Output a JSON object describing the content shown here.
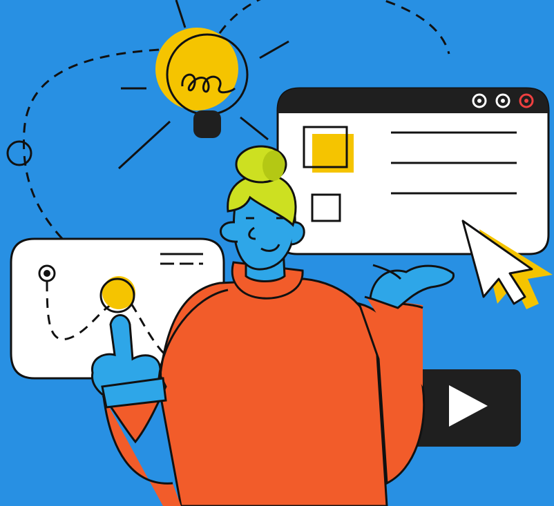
{
  "colors": {
    "background": "#2890E3",
    "bulb": "#F5C400",
    "sweater": "#F25C2A",
    "hair": "#CDE021",
    "skin": "#2EA6E8",
    "outline": "#111111",
    "card": "#FFFFFF",
    "window_bar": "#1F1F1F",
    "close_dot": "#F04040",
    "cursor": "#F5C400",
    "video_tile": "#1F1F1F"
  },
  "icons": {
    "bulb": "lightbulb-icon",
    "cursor": "cursor-arrow-icon",
    "play": "play-icon",
    "pin": "map-pin-icon"
  },
  "window_controls": [
    "minimize",
    "maximize",
    "close"
  ],
  "browser_list_lines": 3,
  "browser_checkboxes": 2,
  "map_pins": 2
}
